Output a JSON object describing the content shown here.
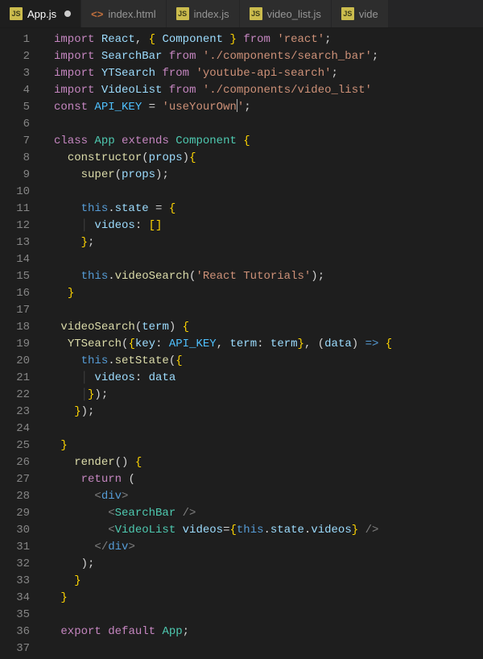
{
  "tabs": [
    {
      "name": "App.js",
      "type": "js",
      "active": true,
      "dirty": true
    },
    {
      "name": "index.html",
      "type": "html",
      "active": false,
      "dirty": false
    },
    {
      "name": "index.js",
      "type": "js",
      "active": false,
      "dirty": false
    },
    {
      "name": "video_list.js",
      "type": "js",
      "active": false,
      "dirty": false
    },
    {
      "name": "vide",
      "type": "js",
      "active": false,
      "dirty": false
    }
  ],
  "visible_lines": 37,
  "code_plain": [
    "import React, { Component } from 'react';",
    "import SearchBar from './components/search_bar';",
    "import YTSearch from 'youtube-api-search';",
    "import VideoList from './components/video_list'",
    "const API_KEY = 'useYourOwn';",
    "",
    "class App extends Component {",
    "  constructor(props){",
    "    super(props);",
    "",
    "    this.state = {",
    "      videos: []",
    "    };",
    "",
    "    this.videoSearch('React Tutorials');",
    "  }",
    "",
    " videoSearch(term) {",
    "  YTSearch({key: API_KEY, term: term}, (data) => {",
    "    this.setState({",
    "      videos: data",
    "     });",
    "   });",
    "",
    " }",
    "   render() {",
    "    return (",
    "      <div>",
    "        <SearchBar />",
    "        <VideoList videos={this.state.videos} />",
    "      </div>",
    "    );",
    "   }",
    " }",
    "",
    " export default App;",
    ""
  ]
}
